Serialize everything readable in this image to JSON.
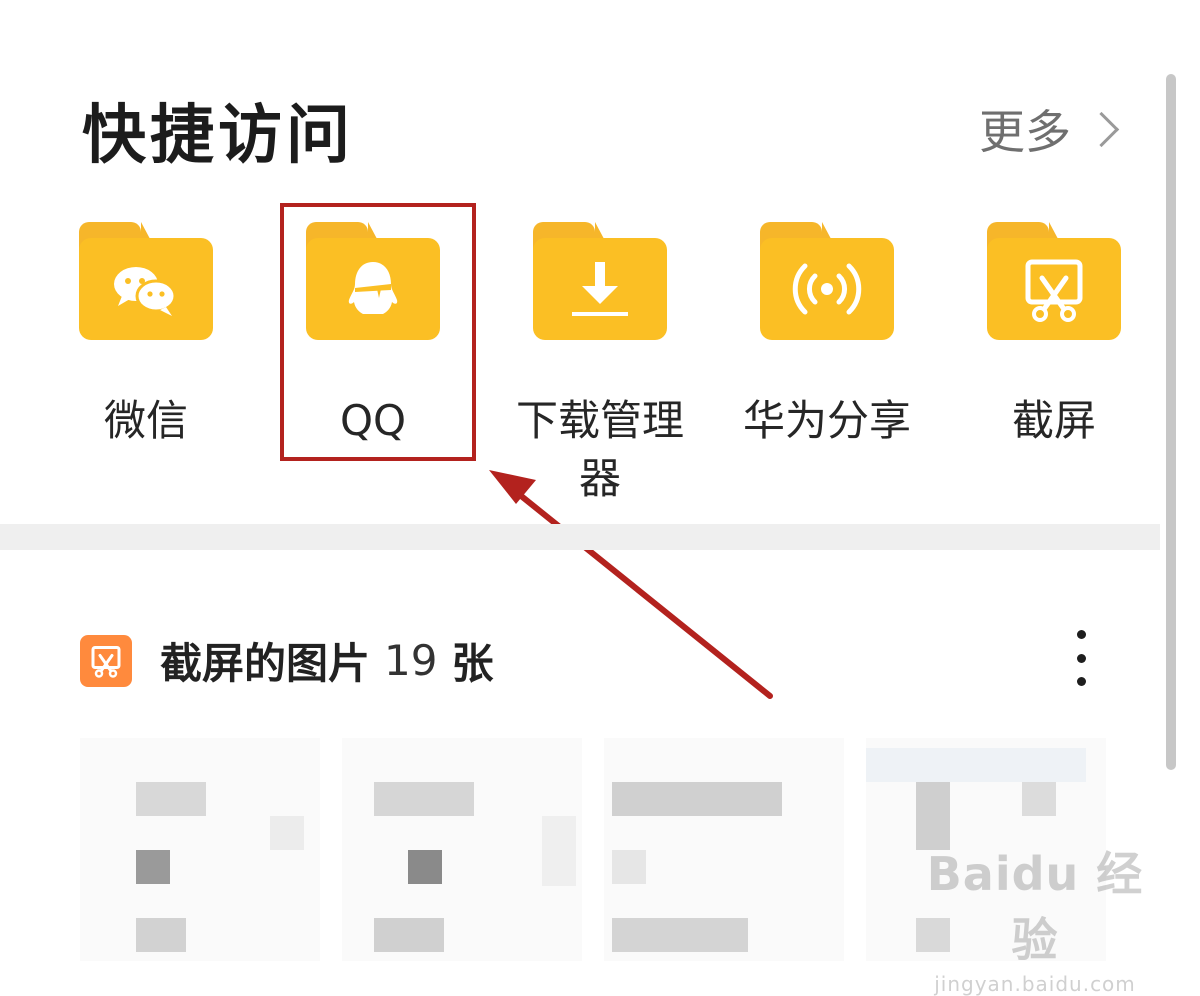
{
  "quick_access": {
    "title": "快捷访问",
    "more_label": "更多",
    "items": [
      {
        "label": "微信",
        "icon": "wechat-icon"
      },
      {
        "label": "QQ",
        "icon": "qq-penguin-icon"
      },
      {
        "label": "下载管理器",
        "icon": "download-icon"
      },
      {
        "label": "华为分享",
        "icon": "huawei-share-icon"
      },
      {
        "label": "截屏",
        "icon": "screenshot-icon"
      }
    ]
  },
  "album": {
    "title": "截屏的图片",
    "count": "19",
    "unit": "张",
    "icon": "screenshot-icon"
  },
  "watermark": {
    "main": "Baidu 经验",
    "url": "jingyan.baidu.com"
  },
  "colors": {
    "folder": "#fbbf24",
    "highlight": "#b3221e",
    "album_icon": "#ff8a3d"
  }
}
